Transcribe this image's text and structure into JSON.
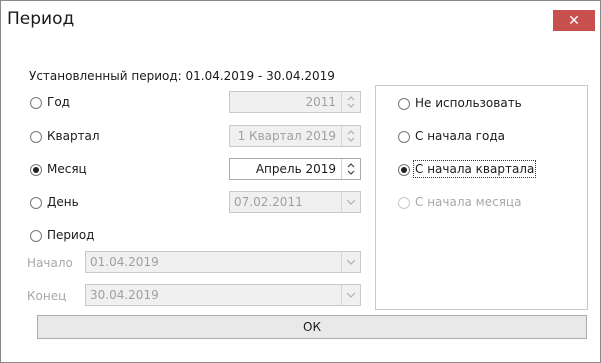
{
  "window": {
    "title": "Период",
    "close_icon": "close-icon",
    "close_glyph": "✕",
    "close_color": "#c7504f"
  },
  "period_label": "Установленный период: 01.04.2019 - 30.04.2019",
  "options": {
    "year": {
      "label": "Год",
      "value": "2011",
      "checked": false
    },
    "quarter": {
      "label": "Квартал",
      "value": "1 Квартал 2019",
      "checked": false
    },
    "month": {
      "label": "Месяц",
      "value": "Апрель 2019",
      "checked": true
    },
    "day": {
      "label": "День",
      "value": "07.02.2011",
      "checked": false
    },
    "period": {
      "label": "Период",
      "checked": false
    }
  },
  "range": {
    "start_label": "Начало",
    "start_value": "01.04.2019",
    "end_label": "Конец",
    "end_value": "30.04.2019"
  },
  "accumulation": {
    "none": {
      "label": "Не использовать",
      "checked": false
    },
    "year_start": {
      "label": "С начала года",
      "checked": false
    },
    "quarter_start": {
      "label": "С начала квартала",
      "checked": true
    },
    "month_start": {
      "label": "С начала месяца",
      "checked": false,
      "disabled": true
    }
  },
  "ok_label": "ОК"
}
